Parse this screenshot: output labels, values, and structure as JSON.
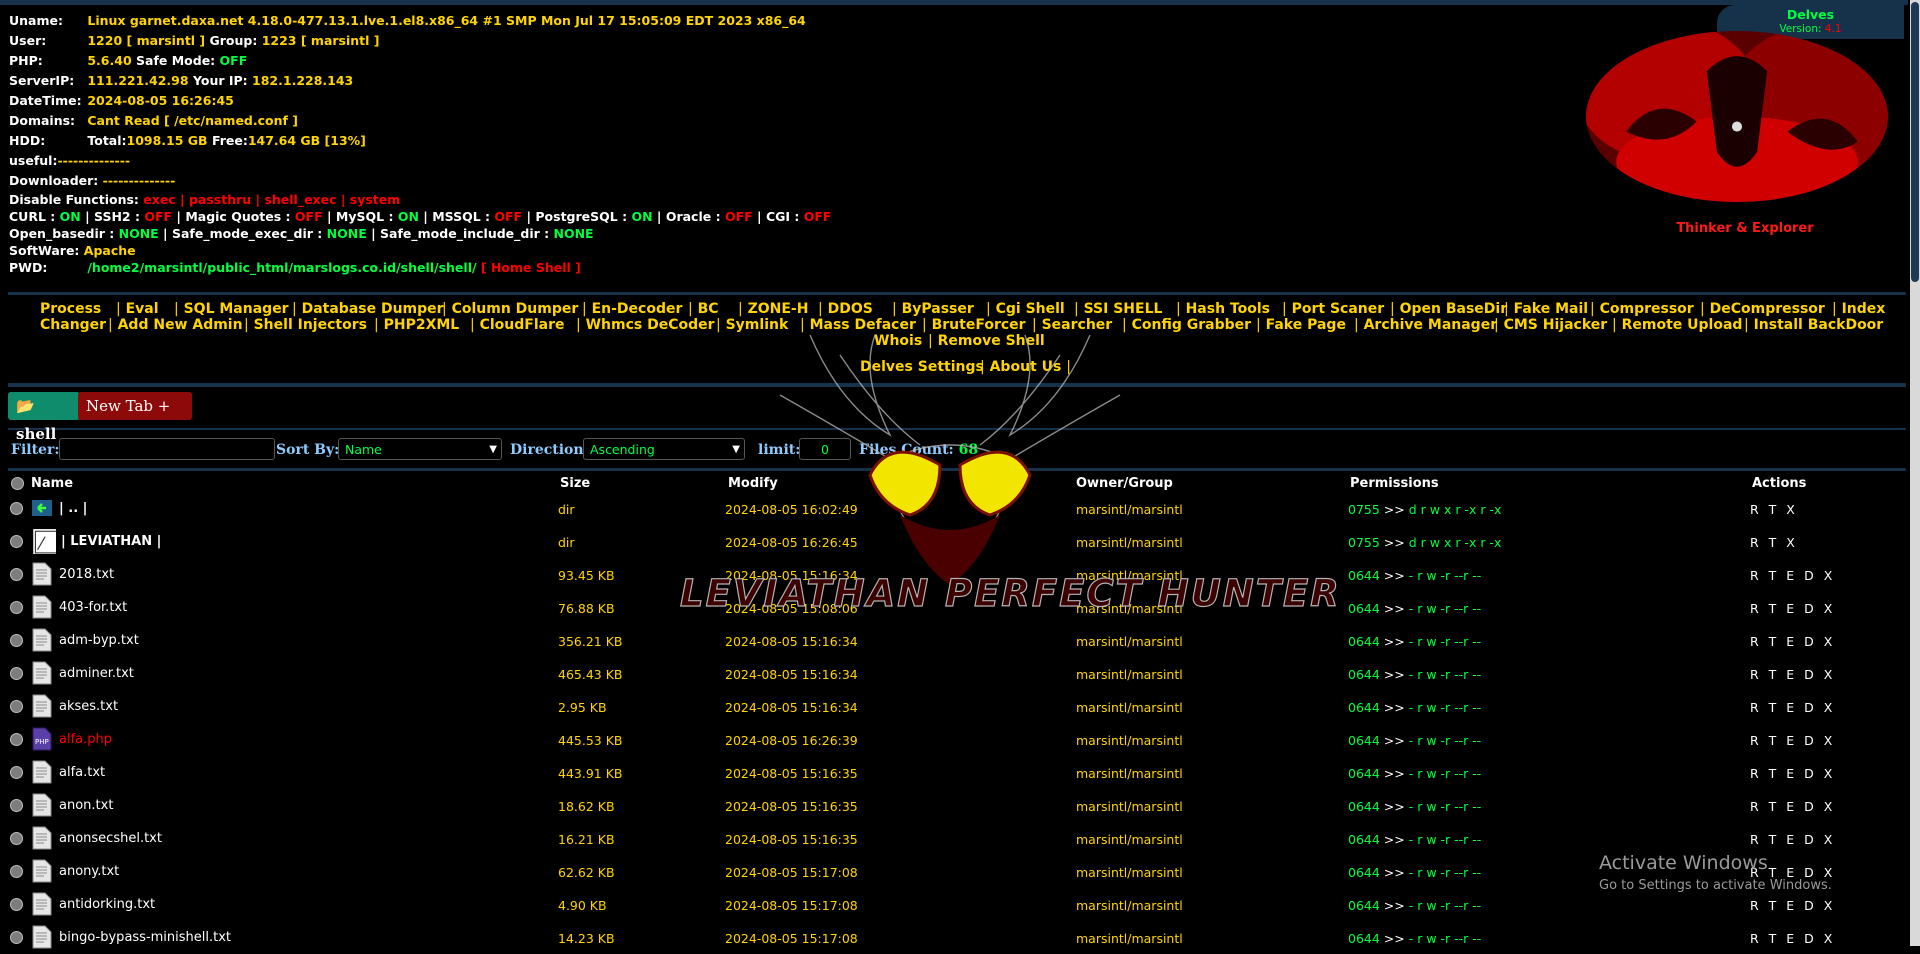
{
  "brand": {
    "title": "Delves",
    "version_label": "Version:",
    "version": "4.1"
  },
  "tagline": "Thinker & Explorer",
  "info": {
    "uname_label": "Uname:",
    "uname": "Linux garnet.daxa.net 4.18.0-477.13.1.lve.1.el8.x86_64 #1 SMP Mon Jul 17 15:05:09 EDT 2023 x86_64",
    "user_label": "User:",
    "user": "1220 [ marsintl ]",
    "group_label": "Group:",
    "group": "1223 [ marsintl ]",
    "php_label": "PHP:",
    "php": "5.6.40",
    "safemode_label": "Safe Mode:",
    "safemode": "OFF",
    "serverip_label": "ServerIP:",
    "serverip": "111.221.42.98",
    "yourip_label": "Your IP:",
    "yourip": "182.1.228.143",
    "datetime_label": "DateTime:",
    "datetime": "2024-08-05 16:26:45",
    "domains_label": "Domains:",
    "domains": "Cant Read [ /etc/named.conf ]",
    "hdd_label": "HDD:",
    "hdd_total_label": "Total:",
    "hdd_total": "1098.15 GB",
    "hdd_free_label": "Free:",
    "hdd_free": "147.64 GB [13%]",
    "useful_label": "useful:",
    "useful": "--------------",
    "downloader_label": "Downloader:",
    "downloader": "--------------",
    "disable_label": "Disable Functions:",
    "disable_functions": "exec | passthru | shell_exec | system",
    "curl_label": "CURL :",
    "curl": "ON",
    "ssh2_label": "SSH2 :",
    "ssh2": "OFF",
    "magic_label": "Magic Quotes :",
    "magic": "OFF",
    "mysql_label": "MySQL :",
    "mysql": "ON",
    "mssql_label": "MSSQL :",
    "mssql": "OFF",
    "pgsql_label": "PostgreSQL :",
    "pgsql": "ON",
    "oracle_label": "Oracle :",
    "oracle": "OFF",
    "cgi_label": "CGI :",
    "cgi": "OFF",
    "openbasedir_label": "Open_basedir :",
    "openbasedir": "NONE",
    "safeexec_label": "Safe_mode_exec_dir :",
    "safeexec": "NONE",
    "safeinclude_label": "Safe_mode_include_dir :",
    "safeinclude": "NONE",
    "software_label": "SoftWare:",
    "software": "Apache",
    "pwd_label": "PWD:",
    "pwd": "/home2/marsintl/public_html/marslogs.co.id/shell/shell/",
    "home_shell": "[ Home Shell ]"
  },
  "menu": {
    "row1": [
      "Process",
      "Eval",
      "SQL Manager",
      "Database Dumper",
      "Column Dumper",
      "En-Decoder",
      "BC",
      "ZONE-H",
      "DDOS",
      "ByPasser",
      "Cgi Shell",
      "SSI SHELL",
      "Hash Tools",
      "Port Scaner",
      "Open BaseDir",
      "Fake Mail",
      "Compressor",
      "DeCompressor",
      "Index"
    ],
    "row2": [
      "Changer",
      "Add New Admin",
      "Shell Injectors",
      "PHP2XML",
      "CloudFlare",
      "Whmcs DeCoder",
      "Symlink",
      "Mass Defacer",
      "BruteForcer",
      "Searcher",
      "Config Grabber",
      "Fake Page",
      "Archive Manager",
      "CMS Hijacker",
      "Remote Upload",
      "Install BackDoor"
    ],
    "row3": [
      "Whois",
      "Remove Shell"
    ],
    "row4": [
      "Delves Settings",
      "About Us"
    ]
  },
  "tabs": {
    "shell": "shell",
    "new_tab": "New Tab +"
  },
  "filter": {
    "filter_label": "Filter:",
    "filter_value": "",
    "sortby_label": "Sort By:",
    "sortby_value": "Name",
    "direction_label": "Direction:",
    "direction_value": "Ascending",
    "limit_label": "limit:",
    "limit_value": "0",
    "files_count_label": "Files Count:",
    "files_count": "68"
  },
  "table": {
    "headers": {
      "name": "Name",
      "size": "Size",
      "modify": "Modify",
      "owner": "Owner/Group",
      "perms": "Permissions",
      "actions": "Actions"
    },
    "rows": [
      {
        "name": "| .. |",
        "icon": "back-icon",
        "size": "dir",
        "modify": "2024-08-05 16:02:49",
        "owner": "marsintl/marsintl",
        "perm_num": "0755",
        "perm_str": "d r w x r -x r -x",
        "actions": "R T X"
      },
      {
        "name": "| LEVIATHAN |",
        "icon": "folder-icon",
        "size": "dir",
        "modify": "2024-08-05 16:26:45",
        "owner": "marsintl/marsintl",
        "perm_num": "0755",
        "perm_str": "d r w x r -x r -x",
        "actions": "R T X"
      },
      {
        "name": "2018.txt",
        "icon": "txt-file-icon",
        "size": "93.45 KB",
        "modify": "2024-08-05 15:16:34",
        "owner": "marsintl/marsintl",
        "perm_num": "0644",
        "perm_str": "- r w -r --r --",
        "actions": "R T E D X"
      },
      {
        "name": "403-for.txt",
        "icon": "txt-file-icon",
        "size": "76.88 KB",
        "modify": "2024-08-05 15:08:06",
        "owner": "marsintl/marsintl",
        "perm_num": "0644",
        "perm_str": "- r w -r --r --",
        "actions": "R T E D X"
      },
      {
        "name": "adm-byp.txt",
        "icon": "txt-file-icon",
        "size": "356.21 KB",
        "modify": "2024-08-05 15:16:34",
        "owner": "marsintl/marsintl",
        "perm_num": "0644",
        "perm_str": "- r w -r --r --",
        "actions": "R T E D X"
      },
      {
        "name": "adminer.txt",
        "icon": "txt-file-icon",
        "size": "465.43 KB",
        "modify": "2024-08-05 15:16:34",
        "owner": "marsintl/marsintl",
        "perm_num": "0644",
        "perm_str": "- r w -r --r --",
        "actions": "R T E D X"
      },
      {
        "name": "akses.txt",
        "icon": "txt-file-icon",
        "size": "2.95 KB",
        "modify": "2024-08-05 15:16:34",
        "owner": "marsintl/marsintl",
        "perm_num": "0644",
        "perm_str": "- r w -r --r --",
        "actions": "R T E D X"
      },
      {
        "name": "alfa.php",
        "icon": "php-file-icon",
        "size": "445.53 KB",
        "modify": "2024-08-05 16:26:39",
        "owner": "marsintl/marsintl",
        "perm_num": "0644",
        "perm_str": "- r w -r --r --",
        "actions": "R T E D X"
      },
      {
        "name": "alfa.txt",
        "icon": "txt-file-icon",
        "size": "443.91 KB",
        "modify": "2024-08-05 15:16:35",
        "owner": "marsintl/marsintl",
        "perm_num": "0644",
        "perm_str": "- r w -r --r --",
        "actions": "R T E D X"
      },
      {
        "name": "anon.txt",
        "icon": "txt-file-icon",
        "size": "18.62 KB",
        "modify": "2024-08-05 15:16:35",
        "owner": "marsintl/marsintl",
        "perm_num": "0644",
        "perm_str": "- r w -r --r --",
        "actions": "R T E D X"
      },
      {
        "name": "anonsecshel.txt",
        "icon": "txt-file-icon",
        "size": "16.21 KB",
        "modify": "2024-08-05 15:16:35",
        "owner": "marsintl/marsintl",
        "perm_num": "0644",
        "perm_str": "- r w -r --r --",
        "actions": "R T E D X"
      },
      {
        "name": "anony.txt",
        "icon": "txt-file-icon",
        "size": "62.62 KB",
        "modify": "2024-08-05 15:17:08",
        "owner": "marsintl/marsintl",
        "perm_num": "0644",
        "perm_str": "- r w -r --r --",
        "actions": "R T E D X"
      },
      {
        "name": "antidorking.txt",
        "icon": "txt-file-icon",
        "size": "4.90 KB",
        "modify": "2024-08-05 15:17:08",
        "owner": "marsintl/marsintl",
        "perm_num": "0644",
        "perm_str": "- r w -r --r --",
        "actions": "R T E D X"
      },
      {
        "name": "bingo-bypass-minishell.txt",
        "icon": "txt-file-icon",
        "size": "14.23 KB",
        "modify": "2024-08-05 15:17:08",
        "owner": "marsintl/marsintl",
        "perm_num": "0644",
        "perm_str": "- r w -r --r --",
        "actions": "R T E D X"
      }
    ]
  },
  "watermark_text": "LEVIATHAN PERFECT HUNTER",
  "activation": {
    "title": "Activate Windows",
    "subtitle": "Go to Settings to activate Windows."
  }
}
